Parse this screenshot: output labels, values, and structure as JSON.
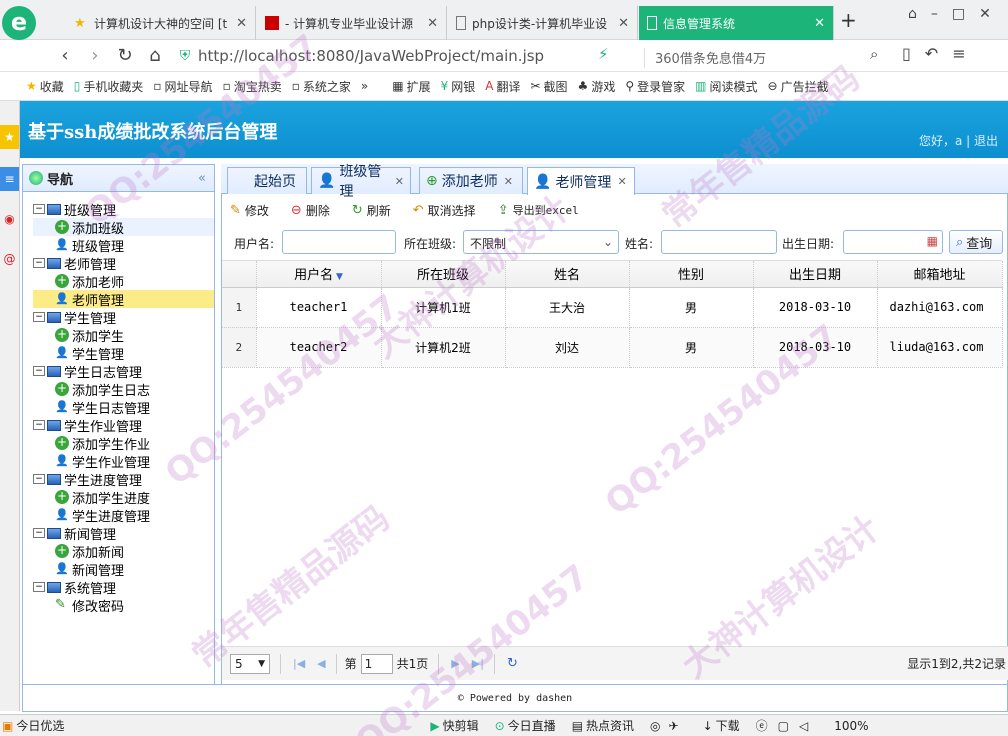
{
  "browser": {
    "tabs": [
      {
        "label": "计算机设计大神的空间 [t",
        "icon": "star-icon"
      },
      {
        "label": "- 计算机专业毕业设计源",
        "icon": "site-icon"
      },
      {
        "label": "php设计类-计算机毕业设",
        "icon": "page-icon"
      },
      {
        "label": "信息管理系统",
        "icon": "page-icon"
      }
    ],
    "url": "http://localhost:8080/JavaWebProject/main.jsp",
    "search_hint": "360借条免息借4万",
    "bookmarks": [
      "收藏",
      "手机收藏夹",
      "网址导航",
      "淘宝热卖",
      "系统之家",
      "扩展",
      "网银",
      "翻译",
      "截图",
      "游戏",
      "登录管家",
      "阅读模式",
      "广告拦截"
    ]
  },
  "app": {
    "title": "基于ssh成绩批改系统后台管理",
    "greeting": "您好，a",
    "logout": "退出"
  },
  "nav": {
    "title": "导航",
    "groups": [
      {
        "label": "班级管理",
        "items": [
          "添加班级",
          "班级管理"
        ]
      },
      {
        "label": "老师管理",
        "items": [
          "添加老师",
          "老师管理"
        ]
      },
      {
        "label": "学生管理",
        "items": [
          "添加学生",
          "学生管理"
        ]
      },
      {
        "label": "学生日志管理",
        "items": [
          "添加学生日志",
          "学生日志管理"
        ]
      },
      {
        "label": "学生作业管理",
        "items": [
          "添加学生作业",
          "学生作业管理"
        ]
      },
      {
        "label": "学生进度管理",
        "items": [
          "添加学生进度",
          "学生进度管理"
        ]
      },
      {
        "label": "新闻管理",
        "items": [
          "添加新闻",
          "新闻管理"
        ]
      },
      {
        "label": "系统管理",
        "items": [
          "修改密码"
        ]
      }
    ]
  },
  "panel_tabs": [
    "起始页",
    "班级管理",
    "添加老师",
    "老师管理"
  ],
  "toolbar": {
    "edit": "修改",
    "delete": "删除",
    "refresh": "刷新",
    "cancel": "取消选择",
    "export": "导出到excel"
  },
  "filter": {
    "username_label": "用户名:",
    "class_label": "所在班级:",
    "class_value": "不限制",
    "name_label": "姓名:",
    "birth_label": "出生日期:",
    "query": "查询"
  },
  "table": {
    "headers": [
      "用户名",
      "所在班级",
      "姓名",
      "性别",
      "出生日期",
      "邮箱地址"
    ],
    "rows": [
      {
        "no": "1",
        "username": "teacher1",
        "class": "计算机1班",
        "name": "王大治",
        "gender": "男",
        "birth": "2018-03-10",
        "email": "dazhi@163.com"
      },
      {
        "no": "2",
        "username": "teacher2",
        "class": "计算机2班",
        "name": "刘达",
        "gender": "男",
        "birth": "2018-03-10",
        "email": "liuda@163.com"
      }
    ]
  },
  "pager": {
    "page_size": "5",
    "page_prefix": "第",
    "page": "1",
    "page_suffix": "共1页",
    "summary": "显示1到2,共2记录"
  },
  "footer": "© Powered by dashen",
  "statusbar": [
    "今日优选",
    "快剪辑",
    "今日直播",
    "热点资讯",
    "下载",
    "100%"
  ],
  "watermarks": [
    "QQ:254540457",
    "大神计算机设计",
    "常年售精品源码"
  ]
}
